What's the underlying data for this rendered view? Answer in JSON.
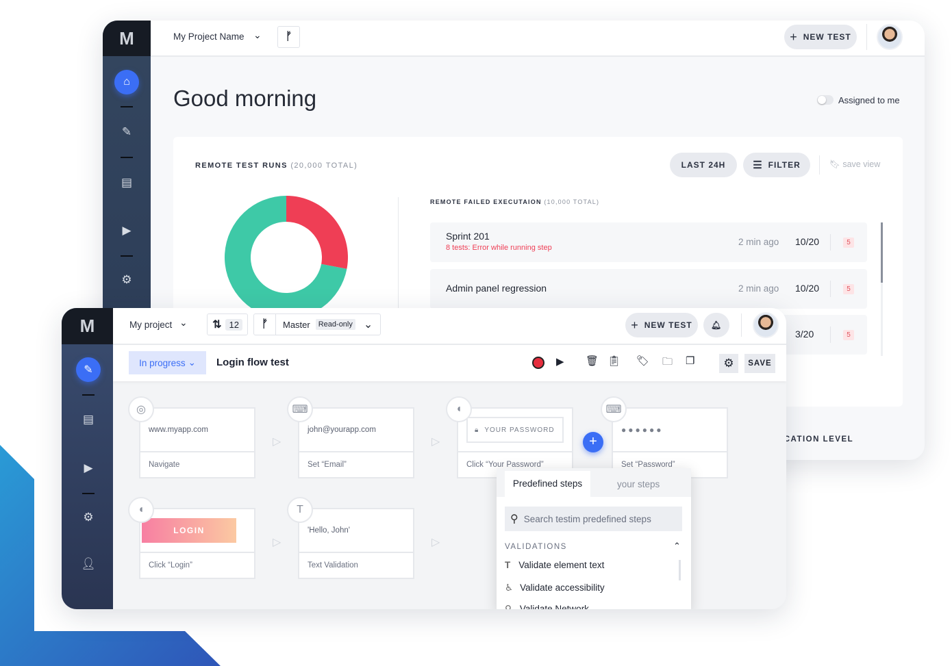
{
  "colors": {
    "accent": "#3b6ef5",
    "error": "#ef3e55",
    "success": "#3ec9a7",
    "sidebar": "#2c3d58"
  },
  "back": {
    "logo": "M",
    "project": "My Project Name",
    "new_test": "NEW TEST",
    "greeting": "Good morning",
    "assigned_toggle": {
      "label": "Assigned to me",
      "on": false
    },
    "runs_title": "REMOTE TEST RUNS",
    "runs_total": "(20,000 TOTAL)",
    "last24": "LAST 24H",
    "filter": "FILTER",
    "save_view": "save view",
    "failed_title": "REMOTE FAILED EXECUTAION",
    "failed_total": "(10,000 TOTAL)",
    "rows": [
      {
        "name": "Sprint 201",
        "error": "8 tests: Error while running step",
        "time": "2 min ago",
        "score": "10/20",
        "badge": "5"
      },
      {
        "name": "Admin panel regression",
        "error": "",
        "time": "2 min ago",
        "score": "10/20",
        "badge": "5"
      },
      {
        "name": "",
        "error": "",
        "time": "",
        "score": "3/20",
        "badge": "5"
      }
    ],
    "level_label": "ICATION LEVEL"
  },
  "chart_data": {
    "type": "pie",
    "donut": true,
    "slices": [
      {
        "color": "#ef3e55",
        "fraction": 0.28
      },
      {
        "color": "#3ec9a7",
        "fraction": 0.72
      }
    ]
  },
  "front": {
    "logo": "M",
    "project": "My project",
    "pr_count": "12",
    "branch": "Master",
    "readonly": "Read-only",
    "new_test": "NEW TEST",
    "status": "In progress",
    "test_name": "Login flow test",
    "save": "SAVE",
    "steps": [
      {
        "value": "www.myapp.com",
        "action": "Navigate",
        "icon": "chrome-icon"
      },
      {
        "value": "john@yourapp.com",
        "action": "Set “Email”",
        "icon": "keyboard-icon"
      },
      {
        "value": "YOUR PASSWORD",
        "action": "Click “Your Password”",
        "icon": "mouse-icon"
      },
      {
        "value": "●●●●●●",
        "action": "Set “Password”",
        "icon": "keyboard-icon"
      },
      {
        "value": "LOGIN",
        "action": "Click “Login”",
        "icon": "mouse-icon"
      },
      {
        "value": "'Hello, John'",
        "action": "Text Validation",
        "icon": "text-icon"
      }
    ],
    "panel": {
      "tabs": [
        "Predefined steps",
        "your steps"
      ],
      "search_placeholder": "Search testim predefined steps",
      "section": "VALIDATIONS",
      "items": [
        "Validate element text",
        "Validate accessibility",
        "Validate Network"
      ]
    }
  }
}
